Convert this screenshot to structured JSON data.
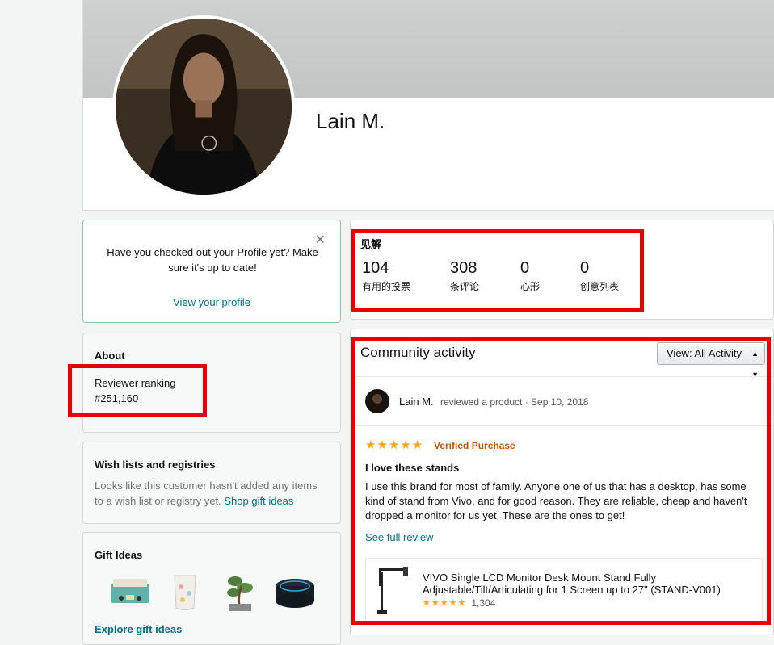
{
  "profile": {
    "name": "Lain M."
  },
  "prompt_card": {
    "message": "Have you checked out your Profile yet? Make sure it's up to date!",
    "link": "View your profile",
    "close_icon": "close-icon"
  },
  "about": {
    "title": "About",
    "ranking_label": "Reviewer ranking",
    "ranking_value": "#251,160"
  },
  "wishlists": {
    "title": "Wish lists and registries",
    "text": "Looks like this customer hasn't added any items to a wish list or registry yet.",
    "link": "Shop gift ideas"
  },
  "gift_ideas": {
    "title": "Gift Ideas",
    "items": [
      "record-player-icon",
      "wine-glass-icon",
      "bonsai-icon",
      "smart-speaker-icon"
    ],
    "link": "Explore gift ideas"
  },
  "insights": {
    "title": "见解",
    "stats": [
      {
        "value": "104",
        "label": "有用的投票"
      },
      {
        "value": "308",
        "label": "条评论"
      },
      {
        "value": "0",
        "label": "心形"
      },
      {
        "value": "0",
        "label": "创意列表"
      }
    ]
  },
  "activity": {
    "title": "Community activity",
    "view_label": "View:  All Activity",
    "entry": {
      "user": "Lain M.",
      "meta": "reviewed a product · Sep 10, 2018",
      "rating": 5,
      "verified": "Verified Purchase",
      "review_title": "I love these stands",
      "review_body": "I use this brand for most of family. Anyone one of us that has a desktop, has some kind of stand from Vivo, and for good reason. They are reliable, cheap and haven't dropped a monitor for us yet. These are the ones to get!",
      "see_full": "See full review",
      "product": {
        "title": "VIVO Single LCD Monitor Desk Mount Stand Fully Adjustable/Tilt/Articulating for 1 Screen up to 27\" (STAND-V001)",
        "rating": 4.5,
        "rating_count": "1,304"
      }
    }
  },
  "colors": {
    "link": "#007185",
    "star": "#ffa41c",
    "verified": "#c45500",
    "highlight": "#e60000"
  }
}
